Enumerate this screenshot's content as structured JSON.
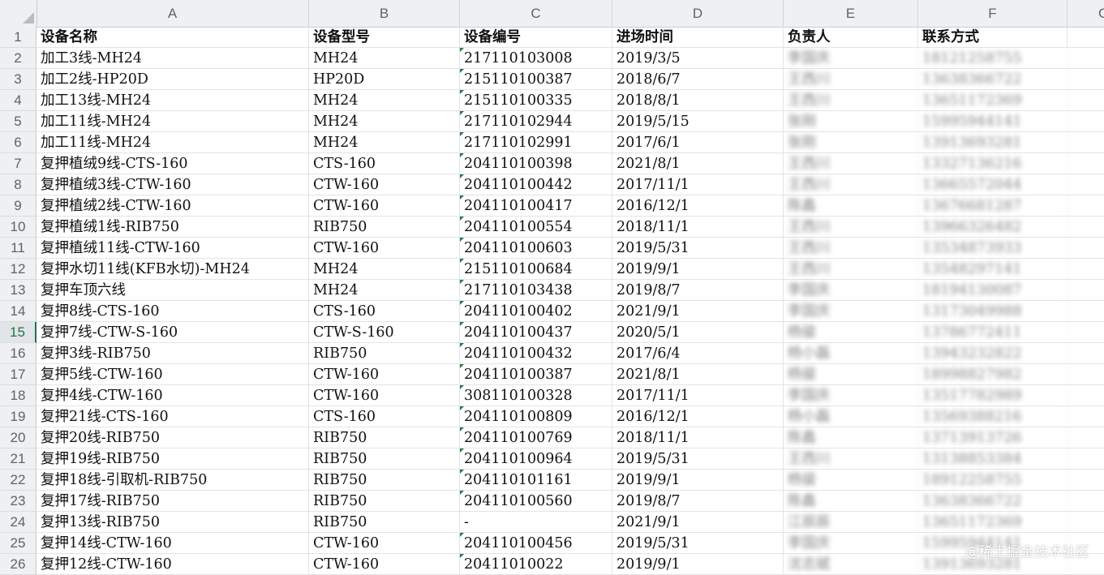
{
  "column_headers": [
    "A",
    "B",
    "C",
    "D",
    "E",
    "F",
    "G"
  ],
  "header_row": {
    "row_number": "1",
    "name": "设备名称",
    "model": "设备型号",
    "serial": "设备编号",
    "date": "进场时间",
    "owner": "负责人",
    "contact": "联系方式"
  },
  "rows": [
    {
      "n": "2",
      "name": "加工3线-MH24",
      "model": "MH24",
      "serial": "217110103008",
      "date": "2019/3/5",
      "owner": "李国庆",
      "contact": "18121258755"
    },
    {
      "n": "3",
      "name": "加工2线-HP20D",
      "model": "HP20D",
      "serial": "215110100387",
      "date": "2018/6/7",
      "owner": "王西川",
      "contact": "13638366722"
    },
    {
      "n": "4",
      "name": "加工13线-MH24",
      "model": "MH24",
      "serial": "215110100335",
      "date": "2018/8/1",
      "owner": "王西川",
      "contact": "13651172369"
    },
    {
      "n": "5",
      "name": "加工11线-MH24",
      "model": "MH24",
      "serial": "217110102944",
      "date": "2019/5/15",
      "owner": "张刚",
      "contact": "15995944141"
    },
    {
      "n": "6",
      "name": "加工11线-MH24",
      "model": "MH24",
      "serial": "217110102991",
      "date": "2017/6/1",
      "owner": "张刚",
      "contact": "13913693281"
    },
    {
      "n": "7",
      "name": "复押植绒9线-CTS-160",
      "model": "CTS-160",
      "serial": "204110100398",
      "date": "2021/8/1",
      "owner": "王西川",
      "contact": "13327136216"
    },
    {
      "n": "8",
      "name": "复押植绒3线-CTW-160",
      "model": "CTW-160",
      "serial": "204110100442",
      "date": "2017/11/1",
      "owner": "王西川",
      "contact": "13665572044"
    },
    {
      "n": "9",
      "name": "复押植绒2线-CTW-160",
      "model": "CTW-160",
      "serial": "204110100417",
      "date": "2016/12/1",
      "owner": "陈鑫",
      "contact": "13676681287"
    },
    {
      "n": "10",
      "name": "复押植绒1线-RIB750",
      "model": "RIB750",
      "serial": "204110100554",
      "date": "2018/11/1",
      "owner": "王西川",
      "contact": "13966326482"
    },
    {
      "n": "11",
      "name": "复押植绒11线-CTW-160",
      "model": "CTW-160",
      "serial": "204110100603",
      "date": "2019/5/31",
      "owner": "王西川",
      "contact": "13534873933"
    },
    {
      "n": "12",
      "name": "复押水切11线(KFB水切)-MH24",
      "model": "MH24",
      "serial": "215110100684",
      "date": "2019/9/1",
      "owner": "王西川",
      "contact": "13548297141"
    },
    {
      "n": "13",
      "name": "复押车顶六线",
      "model": "MH24",
      "serial": "217110103438",
      "date": "2019/8/7",
      "owner": "李国庆",
      "contact": "18194130087"
    },
    {
      "n": "14",
      "name": "复押8线-CTS-160",
      "model": "CTS-160",
      "serial": "204110100402",
      "date": "2021/9/1",
      "owner": "李国庆",
      "contact": "13173049988"
    },
    {
      "n": "15",
      "name": "复押7线-CTW-S-160",
      "model": "CTW-S-160",
      "serial": "204110100437",
      "date": "2020/5/1",
      "owner": "杨骏",
      "contact": "13786772411"
    },
    {
      "n": "16",
      "name": "复押3线-RIB750",
      "model": "RIB750",
      "serial": "204110100432",
      "date": "2017/6/4",
      "owner": "杨小磊",
      "contact": "13943232822"
    },
    {
      "n": "17",
      "name": "复押5线-CTW-160",
      "model": "CTW-160",
      "serial": "204110100387",
      "date": "2021/8/1",
      "owner": "杨骏",
      "contact": "18998827982"
    },
    {
      "n": "18",
      "name": "复押4线-CTW-160",
      "model": "CTW-160",
      "serial": "308110100328",
      "date": "2017/11/1",
      "owner": "李国庆",
      "contact": "13517782989"
    },
    {
      "n": "19",
      "name": "复押21线-CTS-160",
      "model": "CTS-160",
      "serial": "204110100809",
      "date": "2016/12/1",
      "owner": "杨小磊",
      "contact": "13569388216"
    },
    {
      "n": "20",
      "name": "复押20线-RIB750",
      "model": "RIB750",
      "serial": "204110100769",
      "date": "2018/11/1",
      "owner": "陈鑫",
      "contact": "13713913726"
    },
    {
      "n": "21",
      "name": "复押19线-RIB750",
      "model": "RIB750",
      "serial": "204110100964",
      "date": "2019/5/31",
      "owner": "王西川",
      "contact": "13138853384"
    },
    {
      "n": "22",
      "name": "复押18线-引取机-RIB750",
      "model": "RIB750",
      "serial": "204110101161",
      "date": "2019/9/1",
      "owner": "杨骏",
      "contact": "18912258755"
    },
    {
      "n": "23",
      "name": "复押17线-RIB750",
      "model": "RIB750",
      "serial": "204110100560",
      "date": "2019/8/7",
      "owner": "陈鑫",
      "contact": "13638366722"
    },
    {
      "n": "24",
      "name": "复押13线-RIB750",
      "model": "RIB750",
      "serial": "-",
      "date": "2021/9/1",
      "owner": "江辰辰",
      "contact": "13651172369"
    },
    {
      "n": "25",
      "name": "复押14线-CTW-160",
      "model": "CTW-160",
      "serial": "204110100456",
      "date": "2019/5/31",
      "owner": "李国庆",
      "contact": "15995944141"
    },
    {
      "n": "26",
      "name": "复押12线-CTW-160",
      "model": "CTW-160",
      "serial": "20411010022",
      "date": "2019/9/1",
      "owner": "沈志斌",
      "contact": "13913693281"
    }
  ],
  "active_row": "15",
  "watermark": "@稀土掘金技术社区",
  "colors": {
    "header_bg": "#eef0f2",
    "gridline": "#e3e4e6",
    "accent_green": "#217346",
    "text_marker": "#2b7a3b"
  }
}
